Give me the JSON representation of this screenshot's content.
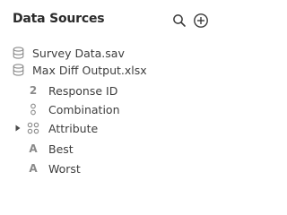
{
  "header": {
    "title": "Data Sources",
    "search_icon": "search-icon",
    "add_icon": "plus-circle-icon"
  },
  "sources": [
    {
      "label": "Survey Data.sav",
      "icon": "database-icon"
    },
    {
      "label": "Max Diff Output.xlsx",
      "icon": "database-icon"
    }
  ],
  "fields": [
    {
      "label": "Response ID",
      "icon": "numeric-icon",
      "glyph": "2"
    },
    {
      "label": "Combination",
      "icon": "categorical-icon"
    },
    {
      "label": "Attribute",
      "icon": "grid-icon",
      "expandable": true
    },
    {
      "label": "Best",
      "icon": "text-icon",
      "glyph": "A"
    },
    {
      "label": "Worst",
      "icon": "text-icon",
      "glyph": "A"
    }
  ],
  "colors": {
    "text": "#3d3d3d",
    "icon": "#8a8a8a",
    "title": "#2b2b2b"
  }
}
